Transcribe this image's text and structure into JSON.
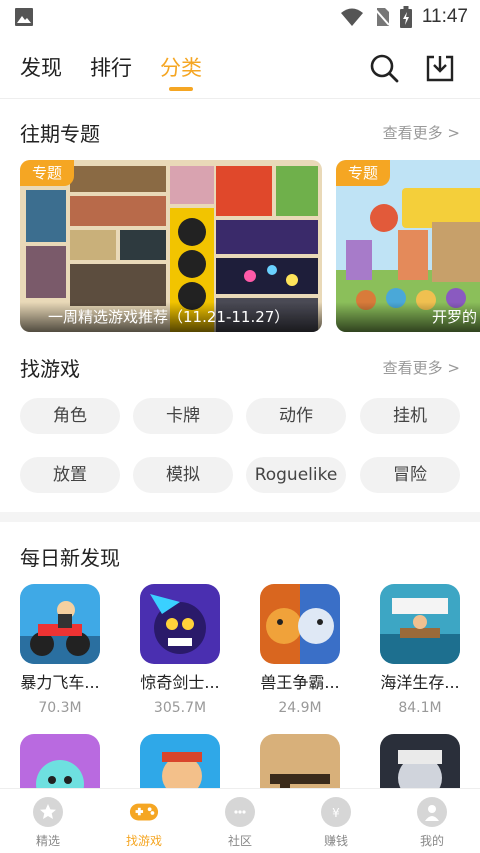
{
  "status_bar": {
    "time": "11:47"
  },
  "top_nav": {
    "tabs": [
      {
        "label": "发现"
      },
      {
        "label": "排行"
      },
      {
        "label": "分类"
      }
    ],
    "active_tab": "分类",
    "accent": "#f5a623"
  },
  "topics": {
    "title": "往期专题",
    "see_more": "查看更多 >",
    "cards": [
      {
        "tag": "专题",
        "caption": "一周精选游戏推荐（11.21-11.27）"
      },
      {
        "tag": "专题",
        "caption": "开罗的"
      }
    ]
  },
  "find_games": {
    "title": "找游戏",
    "see_more": "查看更多 >",
    "chips": [
      "角色",
      "卡牌",
      "动作",
      "挂机",
      "放置",
      "模拟",
      "Roguelike",
      "冒险"
    ]
  },
  "daily": {
    "title": "每日新发现",
    "apps": [
      {
        "name": "暴力飞车...",
        "size": "70.3M",
        "icon": "moto-racer-icon"
      },
      {
        "name": "惊奇剑士...",
        "size": "305.7M",
        "icon": "swordsman-icon"
      },
      {
        "name": "兽王争霸...",
        "size": "24.9M",
        "icon": "beast-lion-wolf-icon"
      },
      {
        "name": "海洋生存...",
        "size": "84.1M",
        "icon": "raft-icon"
      },
      {
        "name": "",
        "size": "",
        "icon": "toca-icon"
      },
      {
        "name": "",
        "size": "",
        "icon": "runner-icon"
      },
      {
        "name": "",
        "size": "",
        "icon": "gun-icon"
      },
      {
        "name": "",
        "size": "",
        "icon": "assassin-icon"
      }
    ]
  },
  "bottom_nav": {
    "items": [
      {
        "label": "精选",
        "icon": "star-icon"
      },
      {
        "label": "找游戏",
        "icon": "gamepad-icon"
      },
      {
        "label": "社区",
        "icon": "chat-icon"
      },
      {
        "label": "赚钱",
        "icon": "money-bag-icon"
      },
      {
        "label": "我的",
        "icon": "user-icon"
      }
    ],
    "active": "找游戏"
  }
}
